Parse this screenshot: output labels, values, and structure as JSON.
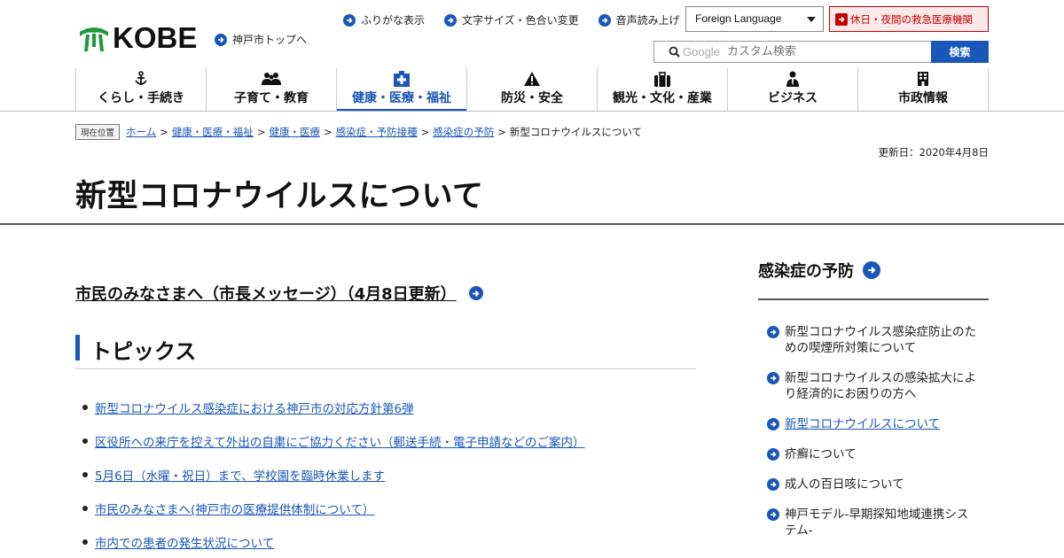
{
  "header": {
    "logo_text": "KOBE",
    "kobe_top": "神戸市トップへ",
    "util": [
      "ふりがな表示",
      "文字サイズ・色合い変更",
      "音声読み上げ"
    ],
    "language_select": "Foreign Language",
    "emergency": "休日・夜間の救急医療機関",
    "search": {
      "brand": "Google",
      "placeholder": "カスタム検索",
      "button": "検索"
    }
  },
  "nav": {
    "items": [
      {
        "label": "くらし・手続き",
        "icon": "anchor-icon"
      },
      {
        "label": "子育て・教育",
        "icon": "people-icon"
      },
      {
        "label": "健康・医療・福祉",
        "icon": "hospital-icon",
        "active": true
      },
      {
        "label": "防災・安全",
        "icon": "warning-icon"
      },
      {
        "label": "観光・文化・産業",
        "icon": "suitcase-icon"
      },
      {
        "label": "ビジネス",
        "icon": "businessperson-icon"
      },
      {
        "label": "市政情報",
        "icon": "building-icon"
      }
    ]
  },
  "breadcrumb": {
    "tag": "現在位置",
    "links": [
      "ホーム",
      "健康・医療・福祉",
      "健康・医療",
      "感染症・予防接種",
      "感染症の予防"
    ],
    "current": "新型コロナウイルスについて",
    "separator": ">"
  },
  "updated": "更新日：2020年4月8日",
  "page_title": "新型コロナウイルスについて",
  "main": {
    "mayor_message": "市民のみなさまへ（市長メッセージ）（4月8日更新）",
    "topics_heading": "トピックス",
    "topics": [
      "新型コロナウイルス感染症における神戸市の対応方針第6弾",
      "区役所への来庁を控えて外出の自粛にご協力ください（郵送手続・電子申請などのご案内）",
      "5月6日（水曜・祝日）まで、学校園を臨時休業します",
      "市民のみなさまへ(神戸市の医療提供体制について）",
      "市内での患者の発生状況について"
    ]
  },
  "sidebar": {
    "heading": "感染症の予防",
    "items": [
      {
        "label": "新型コロナウイルス感染症防止のための喫煙所対策について",
        "link": false
      },
      {
        "label": "新型コロナウイルスの感染拡大により経済的にお困りの方へ",
        "link": false
      },
      {
        "label": "新型コロナウイルスについて",
        "link": true
      },
      {
        "label": "疥癬について",
        "link": false
      },
      {
        "label": "成人の百日咳について",
        "link": false
      },
      {
        "label": "神戸モデル-早期探知地域連携システム-",
        "link": false
      }
    ]
  },
  "colors": {
    "accent": "#1a57b8",
    "emergency": "#c40000",
    "logo_green": "#1a9a3a"
  }
}
